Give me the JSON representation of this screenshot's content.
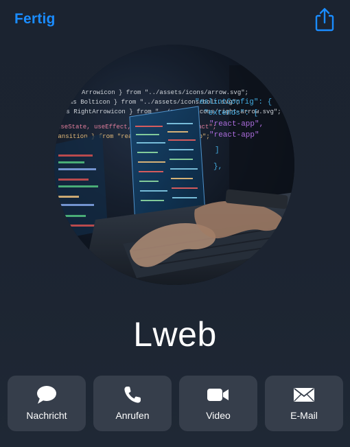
{
  "header": {
    "done_label": "Fertig",
    "share_icon": "share-icon"
  },
  "contact": {
    "name": "Lweb",
    "avatar_code_lines": [
      "Arrowicon } from \"../assets/icons/arrow.svg\";",
      "as Bolticon } from \"../assets/icons/bolt.svg\";",
      "as RightArrowicon } from \"../assets/icons/right-arrow.svg\";",
      "useState, useEffect, useRef } from \"react\";",
      "ransition } from \"react-transition-group\";"
    ],
    "avatar_config_lines": [
      "\"eslintConfig\": {",
      "\"extends\": [",
      "\"react-app\",",
      "\"react-app\"",
      "]",
      "},"
    ]
  },
  "actions": [
    {
      "label": "Nachricht",
      "icon": "message-icon"
    },
    {
      "label": "Anrufen",
      "icon": "phone-icon"
    },
    {
      "label": "Video",
      "icon": "video-icon"
    },
    {
      "label": "E-Mail",
      "icon": "mail-icon"
    }
  ],
  "colors": {
    "accent": "#1a8cff",
    "background": "#1c2431",
    "button_bg": "#363e4b",
    "text": "#ffffff"
  }
}
